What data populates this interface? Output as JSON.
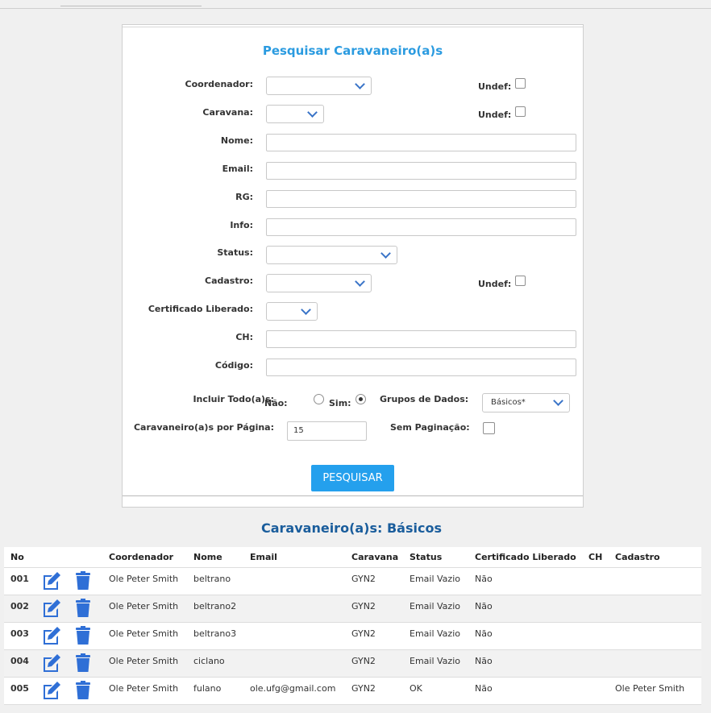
{
  "form": {
    "title": "Pesquisar Caravaneiro(a)s",
    "labels": {
      "coordenador": "Coordenador:",
      "caravana": "Caravana:",
      "nome": "Nome:",
      "email": "Email:",
      "rg": "RG:",
      "info": "Info:",
      "status": "Status:",
      "cadastro": "Cadastro:",
      "certificado": "Certificado Liberado:",
      "ch": "CH:",
      "codigo": "Código:",
      "incluir": "Incluir Todo(a)s:",
      "grupos": "Grupos de Dados:",
      "por_pagina": "Caravaneiro(a)s por Página:",
      "sem_paginacao": "Sem Paginação:"
    },
    "undef_label": "Undef:",
    "radio_nao": "Não:",
    "radio_sim": "Sim:",
    "radio_selected": "sim",
    "grupos_value": "Básicos*",
    "por_pagina_value": "15",
    "search_button": "PESQUISAR"
  },
  "results": {
    "title": "Caravaneiro(a)s: Básicos",
    "columns": [
      "No",
      "",
      "",
      "Coordenador",
      "Nome",
      "Email",
      "Caravana",
      "Status",
      "Certificado Liberado",
      "CH",
      "Cadastro"
    ],
    "rows": [
      {
        "no": "001",
        "coordenador": "Ole Peter Smith",
        "nome": "beltrano",
        "email": "",
        "caravana": "GYN2",
        "status": "Email Vazio",
        "certificado": "Não",
        "ch": "",
        "cadastro": ""
      },
      {
        "no": "002",
        "coordenador": "Ole Peter Smith",
        "nome": "beltrano2",
        "email": "",
        "caravana": "GYN2",
        "status": "Email Vazio",
        "certificado": "Não",
        "ch": "",
        "cadastro": ""
      },
      {
        "no": "003",
        "coordenador": "Ole Peter Smith",
        "nome": "beltrano3",
        "email": "",
        "caravana": "GYN2",
        "status": "Email Vazio",
        "certificado": "Não",
        "ch": "",
        "cadastro": ""
      },
      {
        "no": "004",
        "coordenador": "Ole Peter Smith",
        "nome": "ciclano",
        "email": "",
        "caravana": "GYN2",
        "status": "Email Vazio",
        "certificado": "Não",
        "ch": "",
        "cadastro": ""
      },
      {
        "no": "005",
        "coordenador": "Ole Peter Smith",
        "nome": "fulano",
        "email": "ole.ufg@gmail.com",
        "caravana": "GYN2",
        "status": "OK",
        "certificado": "Não",
        "ch": "",
        "cadastro": "Ole Peter Smith"
      }
    ]
  },
  "icons": {
    "edit": "edit-icon",
    "delete": "trash-icon"
  },
  "colors": {
    "accent": "#24a0ed",
    "title": "#2b9be0",
    "results_title": "#1a5d9c",
    "icon": "#2f6fd6"
  }
}
